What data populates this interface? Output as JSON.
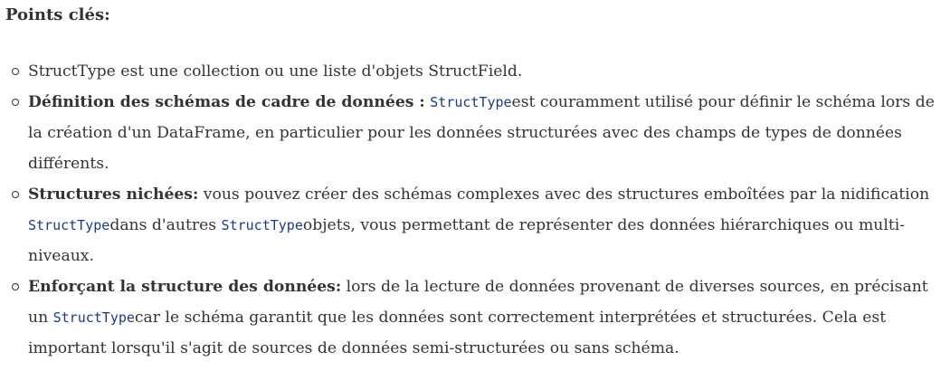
{
  "heading": "Points clés:",
  "items": [
    {
      "title": "",
      "text_before": "StructType est une collection ou une liste d'objets StructField.",
      "code_1": "",
      "text_mid": "",
      "code_2": "",
      "text_after": ""
    },
    {
      "title": "Définition des schémas de cadre de données :",
      "text_before": " ",
      "code_1": "StructType",
      "text_mid": "est couramment utilisé pour définir le schéma lors de la création d'un DataFrame, en particulier pour les données structurées avec des champs de types de données différents.",
      "code_2": "",
      "text_after": ""
    },
    {
      "title": "Structures nichées:",
      "text_before": " vous pouvez créer des schémas complexes avec des structures emboîtées par la nidification ",
      "code_1": "StructType",
      "text_mid": "dans d'autres ",
      "code_2": "StructType",
      "text_after": "objets, vous permettant de représenter des données hiérarchiques ou multi-niveaux."
    },
    {
      "title": "Enforçant la structure des données:",
      "text_before": " lors de la lecture de données provenant de diverses sources, en précisant un ",
      "code_1": "StructType",
      "text_mid": "car le schéma garantit que les données sont correctement interprétées et structurées. Cela est important lorsqu'il s'agit de sources de données semi-structurées ou sans schéma.",
      "code_2": "",
      "text_after": ""
    }
  ]
}
